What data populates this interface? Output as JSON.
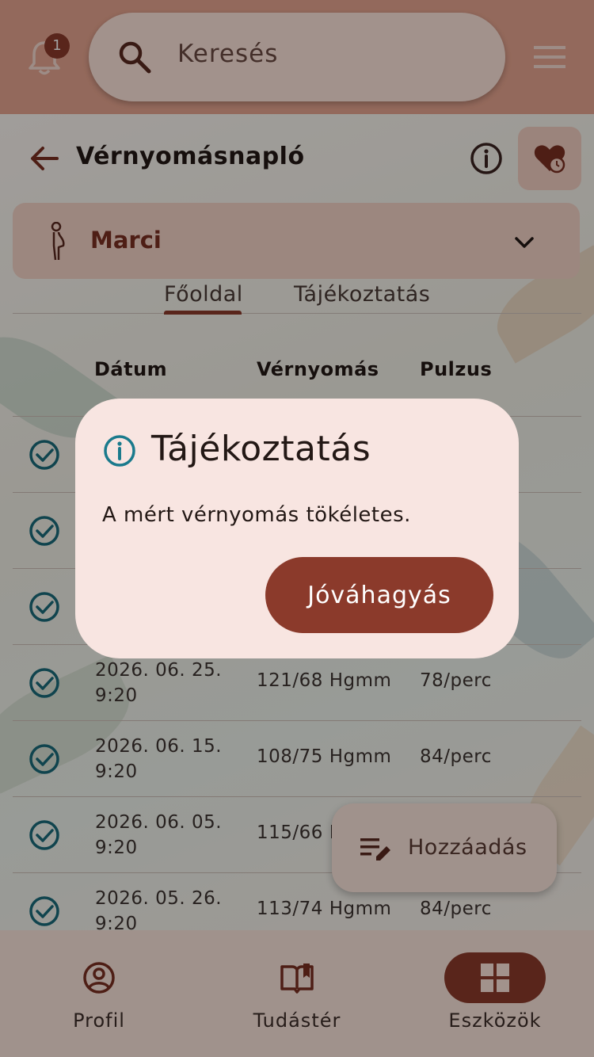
{
  "notifications": {
    "count": "1"
  },
  "search": {
    "placeholder": "Keresés"
  },
  "header": {
    "title": "Vérnyomásnapló"
  },
  "person": {
    "name": "Marci"
  },
  "tabs": [
    {
      "label": "Főoldal",
      "active": true
    },
    {
      "label": "Tájékoztatás",
      "active": false
    }
  ],
  "table": {
    "columns": [
      "Dátum",
      "Vérnyomás",
      "Pulzus"
    ],
    "rows": [
      {
        "date": "",
        "bp": "",
        "pulse": ""
      },
      {
        "date": "",
        "bp": "",
        "pulse": ""
      },
      {
        "date": "",
        "bp": "",
        "pulse": ""
      },
      {
        "date": "2026. 06. 25. 9:20",
        "bp": "121/68 Hgmm",
        "pulse": "78/perc"
      },
      {
        "date": "2026. 06. 15. 9:20",
        "bp": "108/75 Hgmm",
        "pulse": "84/perc"
      },
      {
        "date": "2026. 06. 05. 9:20",
        "bp": "115/66 Hgmm",
        "pulse": ""
      },
      {
        "date": "2026. 05. 26. 9:20",
        "bp": "113/74 Hgmm",
        "pulse": "84/perc"
      }
    ]
  },
  "fab": {
    "label": "Hozzáadás"
  },
  "bottom_nav": [
    {
      "label": "Profil",
      "icon": "person-circle-icon",
      "active": false
    },
    {
      "label": "Tudástér",
      "icon": "open-book-icon",
      "active": false
    },
    {
      "label": "Eszközök",
      "icon": "grid-icon",
      "active": true
    }
  ],
  "dialog": {
    "title": "Tájékoztatás",
    "body": "A mért vérnyomás tökéletes.",
    "confirm_label": "Jóváhagyás"
  },
  "colors": {
    "primary": "#8b3a2b",
    "topbar": "#e7a590",
    "teal_icon": "#1a6b7a",
    "dialog_bg": "#f8e5e1"
  }
}
